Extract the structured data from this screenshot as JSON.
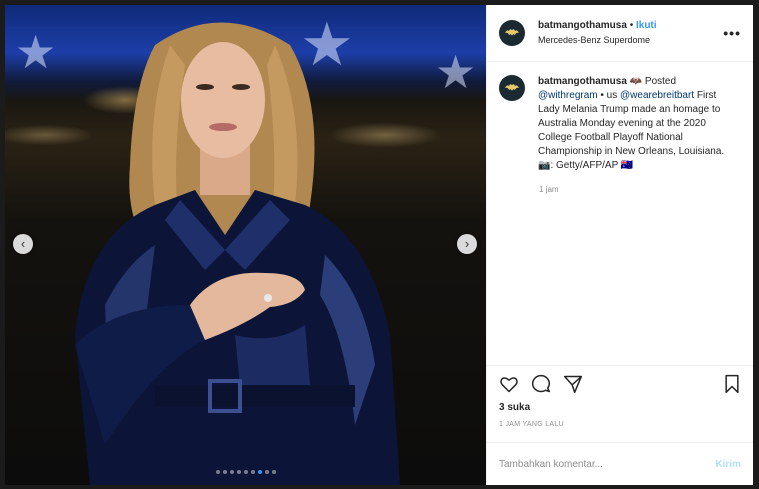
{
  "post": {
    "username": "batmangothamusa",
    "dot": "•",
    "follow_label": "Ikuti",
    "location": "Mercedes-Benz Superdome",
    "more_label": "•••",
    "caption_user": "batmangothamusa",
    "caption_part1": " 🦇 Posted ",
    "mention1": "@withregram",
    "caption_part2": " • us ",
    "mention2": "@wearebreitbart",
    "caption_body": " First Lady Melania Trump made an homage to Australia Monday evening at the 2020 College Football Playoff National Championship in New Orleans, Louisiana. 📷: Getty/AFP/AP 🇦🇺",
    "comment_time": "1 jam",
    "likes": "3 suka",
    "time_ago": "1 JAM YANG LALU",
    "comment_placeholder": "Tambahkan komentar...",
    "post_label": "Kirim"
  },
  "carousel": {
    "prev": "‹",
    "next": "›",
    "total_slides": 9,
    "active_slide": 7
  },
  "icons": {
    "like": "heart-icon",
    "comment": "comment-icon",
    "share": "share-icon",
    "save": "bookmark-icon",
    "avatar": "bat-avatar-icon"
  },
  "colors": {
    "link": "#3897f0",
    "mention": "#00376b",
    "text": "#262626",
    "muted": "#8e8e8e"
  }
}
